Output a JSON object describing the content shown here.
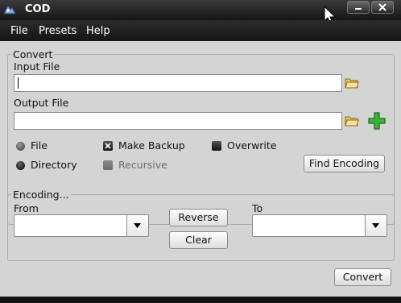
{
  "window": {
    "title": "COD"
  },
  "menu": {
    "items": [
      "File",
      "Presets",
      "Help"
    ]
  },
  "convert_group": {
    "legend": "Convert",
    "input_label": "Input File",
    "input_value": "",
    "output_label": "Output File",
    "output_value": "",
    "source_options": [
      "File",
      "Directory"
    ],
    "make_backup_label": "Make Backup",
    "make_backup_checked": true,
    "recursive_label": "Recursive",
    "recursive_enabled": false,
    "overwrite_label": "Overwrite",
    "overwrite_checked": false,
    "find_encoding_button": "Find Encoding"
  },
  "encoding_group": {
    "legend": "Encoding...",
    "from_label": "From",
    "from_value": "",
    "to_label": "To",
    "to_value": "",
    "reverse_button": "Reverse",
    "clear_button": "Clear"
  },
  "convert_button": "Convert"
}
